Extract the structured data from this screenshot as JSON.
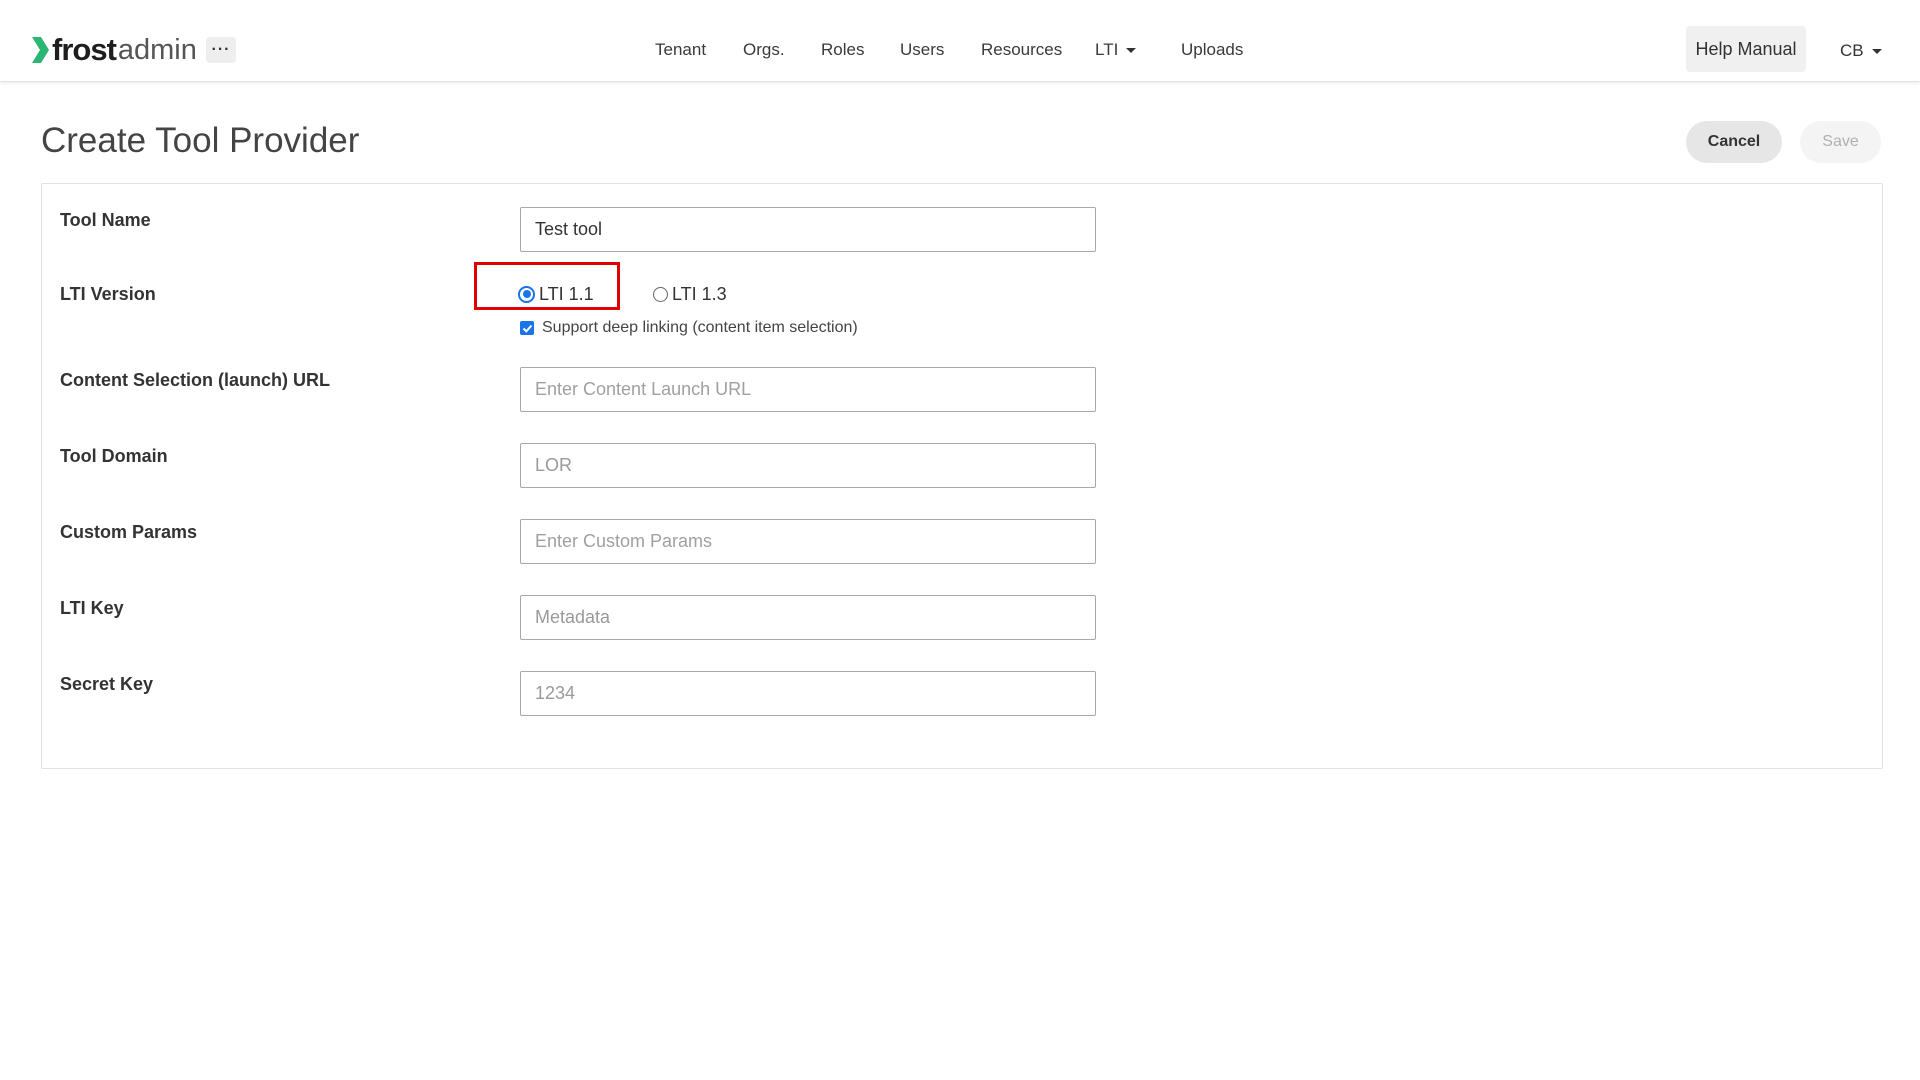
{
  "header": {
    "logo_brand": "frost",
    "logo_suffix": "admin",
    "more_label": "···",
    "nav": [
      {
        "label": "Tenant"
      },
      {
        "label": "Orgs."
      },
      {
        "label": "Roles"
      },
      {
        "label": "Users"
      },
      {
        "label": "Resources"
      },
      {
        "label": "LTI"
      },
      {
        "label": "Uploads"
      }
    ],
    "help_label": "Help Manual",
    "user_initials": "CB"
  },
  "page": {
    "title": "Create Tool Provider",
    "cancel_label": "Cancel",
    "save_label": "Save"
  },
  "form": {
    "tool_name": {
      "label": "Tool Name",
      "value": "Test tool"
    },
    "lti_version": {
      "label": "LTI Version",
      "options": [
        {
          "label": "LTI 1.1",
          "selected": true
        },
        {
          "label": "LTI 1.3",
          "selected": false
        }
      ],
      "deep_linking_label": "Support deep linking (content item selection)",
      "deep_linking_checked": true
    },
    "launch_url": {
      "label": "Content Selection (launch) URL",
      "placeholder": "Enter Content Launch URL"
    },
    "tool_domain": {
      "label": "Tool Domain",
      "value": "LOR"
    },
    "custom_params": {
      "label": "Custom Params",
      "placeholder": "Enter Custom Params"
    },
    "lti_key": {
      "label": "LTI Key",
      "value": "Metadata"
    },
    "secret_key": {
      "label": "Secret Key",
      "value": "1234"
    }
  },
  "colors": {
    "accent": "#1a73e8",
    "logo_green": "#2bb673",
    "highlight": "#e00000"
  }
}
